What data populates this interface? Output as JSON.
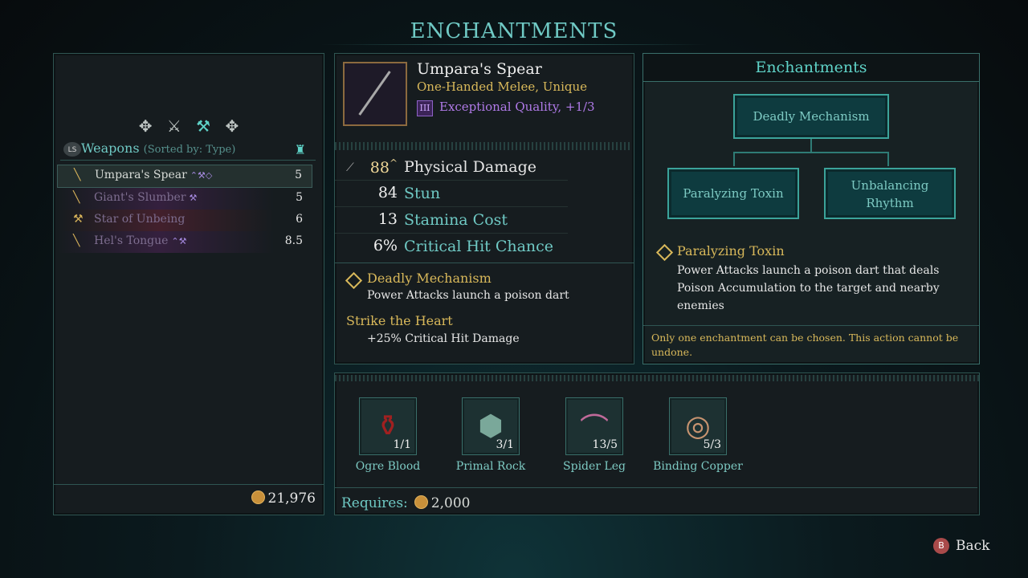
{
  "page_title": "ENCHANTMENTS",
  "weapons": {
    "badge": "LS",
    "title": "Weapons",
    "sorted_by": "(Sorted by: Type)",
    "items": [
      {
        "name": "Umpara's Spear",
        "value": "5",
        "selected": true
      },
      {
        "name": "Giant's Slumber",
        "value": "5",
        "selected": false
      },
      {
        "name": "Star of Unbeing",
        "value": "6",
        "selected": false
      },
      {
        "name": "Hel's Tongue",
        "value": "8.5",
        "selected": false
      }
    ],
    "gold_total": "21,976"
  },
  "item": {
    "name": "Umpara's Spear",
    "type": "One-Handed Melee, Unique",
    "quality_badge": "III",
    "quality": "Exceptional Quality, +1/3",
    "stats": [
      {
        "value": "88",
        "label": "Physical Damage",
        "arrow": "^"
      },
      {
        "value": "84",
        "label": "Stun"
      },
      {
        "value": "13",
        "label": "Stamina Cost"
      },
      {
        "value": "6%",
        "label": "Critical Hit Chance"
      }
    ],
    "enchant_title": "Deadly Mechanism",
    "enchant_desc": "Power Attacks launch a poison dart",
    "bonus_title": "Strike the Heart",
    "bonus_desc": "+25% Critical Hit Damage"
  },
  "enchantments": {
    "title": "Enchantments",
    "root": "Deadly Mechanism",
    "left": "Paralyzing Toxin",
    "right_line1": "Unbalancing",
    "right_line2": "Rhythm",
    "selected_title": "Paralyzing Toxin",
    "selected_desc": "Power Attacks launch a poison dart that deals Poison Accumulation to the target and nearby enemies",
    "warning": "Only one enchantment can be chosen. This action cannot be undone."
  },
  "materials": [
    {
      "name": "Ogre Blood",
      "count": "1/1",
      "icon": "potion-icon"
    },
    {
      "name": "Primal Rock",
      "count": "3/1",
      "icon": "rock-icon"
    },
    {
      "name": "Spider Leg",
      "count": "13/5",
      "icon": "spider-leg-icon"
    },
    {
      "name": "Binding Copper",
      "count": "5/3",
      "icon": "copper-rings-icon"
    }
  ],
  "requires": {
    "label": "Requires:",
    "amount": "2,000"
  },
  "back": {
    "button": "B",
    "label": "Back"
  },
  "colors": {
    "accent": "#5fd3c8",
    "gold": "#d8b85a",
    "purple": "#b07ae8"
  }
}
